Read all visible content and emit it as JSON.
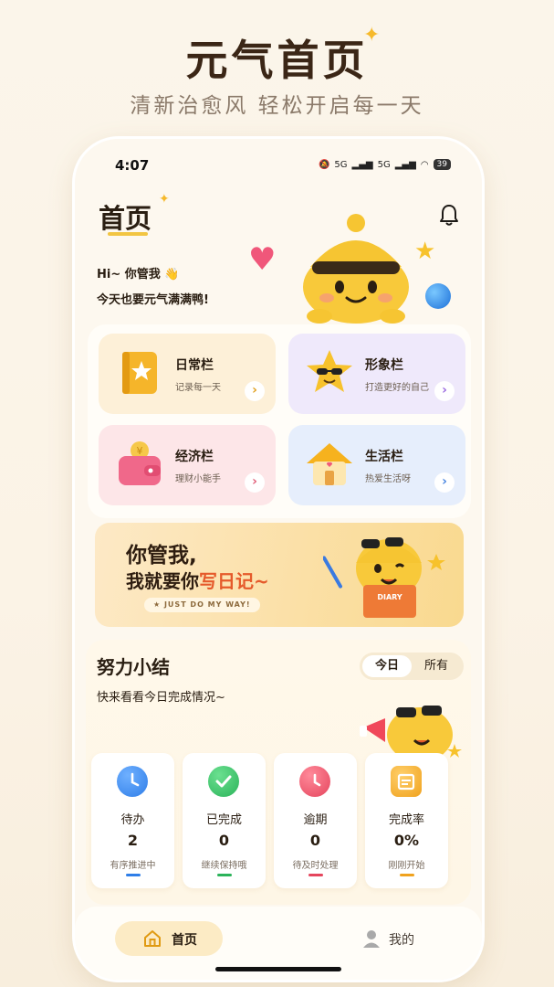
{
  "promo": {
    "title": "元气首页",
    "subtitle": "清新治愈风 轻松开启每一天"
  },
  "status_bar": {
    "time": "4:07",
    "signal1": "5G",
    "signal2": "5G",
    "battery": "39"
  },
  "header": {
    "title": "首页",
    "greeting_line1": "Hi~ 你管我 👋",
    "greeting_line2": "今天也要元气满满鸭!"
  },
  "categories": [
    {
      "name": "日常栏",
      "desc": "记录每一天",
      "bg": "#fdf0d8",
      "arrow_color": "#e0a020"
    },
    {
      "name": "形象栏",
      "desc": "打造更好的自己",
      "bg": "#efe9fb",
      "arrow_color": "#9b6be0"
    },
    {
      "name": "经济栏",
      "desc": "理财小能手",
      "bg": "#fde6e8",
      "arrow_color": "#e0607a"
    },
    {
      "name": "生活栏",
      "desc": "热爱生活呀",
      "bg": "#e6eefc",
      "arrow_color": "#4a86e0"
    }
  ],
  "banner": {
    "line1": "你管我,",
    "line2_prefix": "我就要你",
    "line2_highlight": "写日记~",
    "pill": "★ JUST DO MY WAY!",
    "book_label": "DIARY"
  },
  "summary": {
    "title": "努力小结",
    "subtitle": "快来看看今日完成情况~",
    "tabs": [
      "今日",
      "所有"
    ],
    "stats": [
      {
        "label": "待办",
        "value": "2",
        "hint": "有序推进中",
        "color": "#2f7ee8"
      },
      {
        "label": "已完成",
        "value": "0",
        "hint": "继续保持哦",
        "color": "#2bb35a"
      },
      {
        "label": "逾期",
        "value": "0",
        "hint": "待及时处理",
        "color": "#e5455d"
      },
      {
        "label": "完成率",
        "value": "0%",
        "hint": "刚刚开始",
        "color": "#f0a21e"
      }
    ]
  },
  "tabbar": {
    "home": "首页",
    "me": "我的"
  }
}
